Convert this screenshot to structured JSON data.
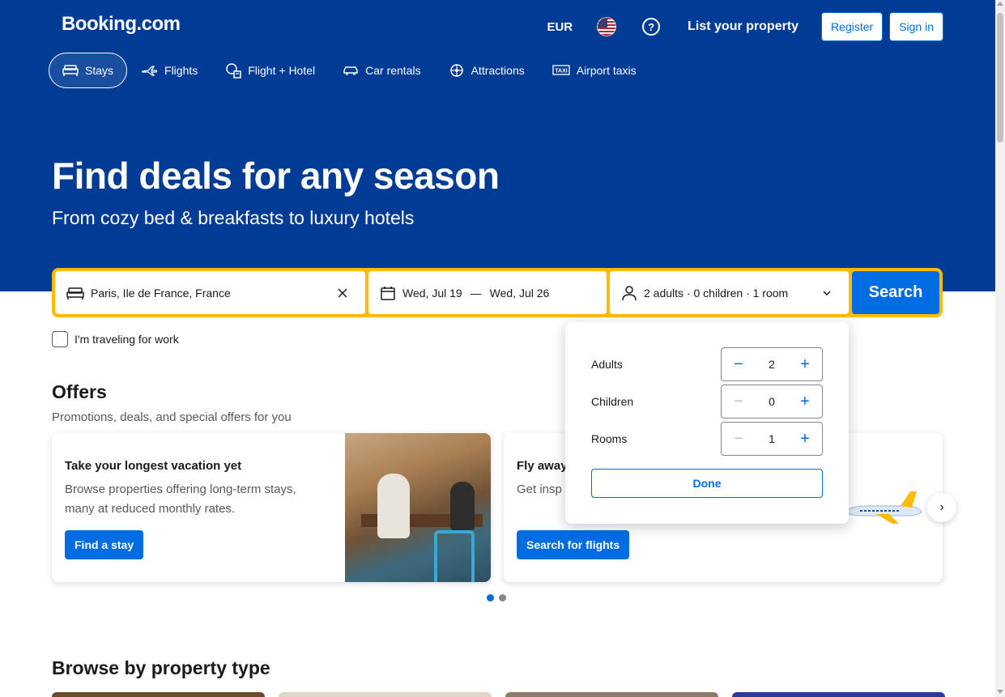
{
  "header": {
    "logo": "Booking.com",
    "currency": "EUR",
    "help_icon": "?",
    "list_property": "List your property",
    "register": "Register",
    "sign_in": "Sign in"
  },
  "nav": {
    "items": [
      {
        "label": "Stays",
        "icon": "bed-icon",
        "active": true
      },
      {
        "label": "Flights",
        "icon": "plane-icon"
      },
      {
        "label": "Flight + Hotel",
        "icon": "flight-hotel-icon"
      },
      {
        "label": "Car rentals",
        "icon": "car-icon"
      },
      {
        "label": "Attractions",
        "icon": "attractions-icon"
      },
      {
        "label": "Airport taxis",
        "icon": "taxi-icon"
      }
    ]
  },
  "hero": {
    "title": "Find deals for any season",
    "subtitle": "From cozy bed & breakfasts to luxury hotels"
  },
  "search": {
    "destination": "Paris, Ile de France, France",
    "check_in": "Wed, Jul 19",
    "separator": "—",
    "check_out": "Wed, Jul 26",
    "guests": "2 adults · 0 children · 1 room",
    "button": "Search",
    "work_label": "I'm traveling for work"
  },
  "guest_popup": {
    "rows": [
      {
        "label": "Adults",
        "value": "2",
        "minus_enabled": true
      },
      {
        "label": "Children",
        "value": "0",
        "minus_enabled": false
      },
      {
        "label": "Rooms",
        "value": "1",
        "minus_enabled": false
      }
    ],
    "done": "Done"
  },
  "offers": {
    "title": "Offers",
    "subtitle": "Promotions, deals, and special offers for you",
    "cards": [
      {
        "title": "Take your longest vacation yet",
        "desc": "Browse properties offering long-term stays, many at reduced monthly rates.",
        "button": "Find a stay"
      },
      {
        "title": "Fly away",
        "desc": "Get insp flexibility",
        "button": "Search for flights"
      }
    ],
    "next_icon": "›"
  },
  "browse": {
    "title": "Browse by property type"
  },
  "colors": {
    "brand_blue": "#003b95",
    "action_blue": "#006ce4",
    "search_yellow": "#febb02"
  }
}
